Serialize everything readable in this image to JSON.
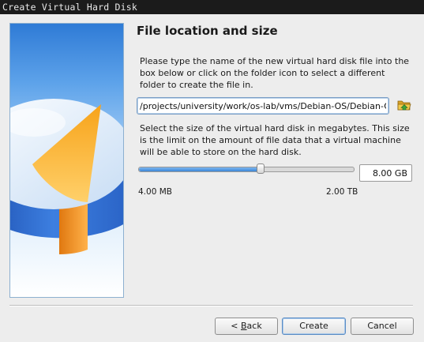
{
  "window": {
    "title": "Create Virtual Hard Disk"
  },
  "page": {
    "heading": "File location and size",
    "location_description": "Please type the name of the new virtual hard disk file into the box below or click on the folder icon to select a different folder to create the file in.",
    "file_path": "/projects/university/work/os-lab/vms/Debian-OS/Debian-OS.vdi",
    "size_description": "Select the size of the virtual hard disk in megabytes. This size is the limit on the amount of file data that a virtual machine will be able to store on the hard disk.",
    "size_value": "8.00 GB",
    "size_slider_fraction": 0.57,
    "size_min_label": "4.00 MB",
    "size_max_label": "2.00 TB"
  },
  "buttons": {
    "back_prefix": "< ",
    "back_mnemonic": "B",
    "back_rest": "ack",
    "create": "Create",
    "cancel": "Cancel"
  },
  "icons": {
    "folder": "folder-open-icon",
    "banner": "hard-disk-illustration"
  },
  "colors": {
    "accent": "#3b86d6",
    "title_bar": "#1b1b1b"
  }
}
